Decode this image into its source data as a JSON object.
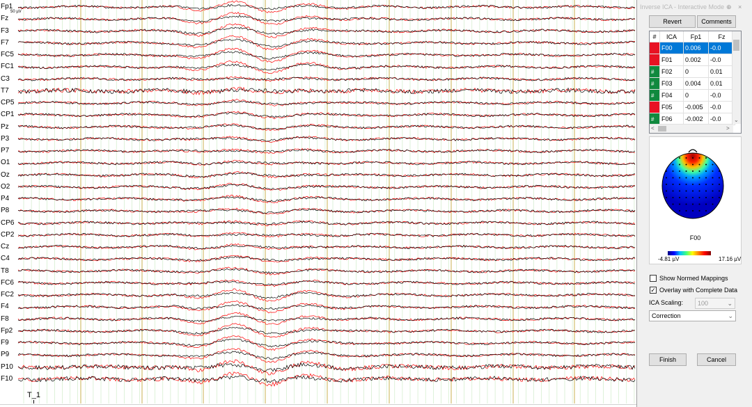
{
  "eeg": {
    "channels": [
      "Fp1",
      "Fz",
      "F3",
      "F7",
      "FC5",
      "FC1",
      "C3",
      "T7",
      "CP5",
      "CP1",
      "Pz",
      "P3",
      "P7",
      "O1",
      "Oz",
      "O2",
      "P4",
      "P8",
      "CP6",
      "CP2",
      "Cz",
      "C4",
      "T8",
      "FC6",
      "FC2",
      "F4",
      "F8",
      "Fp2",
      "F9",
      "P9",
      "P10",
      "F10"
    ],
    "scale_label": "50 µV",
    "marker_label": "T_1",
    "colors": {
      "raw": "#000000",
      "corrected": "#ff0000",
      "major_grid": "#c8b050",
      "minor_grid": "#c8e8c0"
    }
  },
  "panel": {
    "title": "Inverse ICA - Interactive Mode",
    "title_pin": "⊕",
    "title_close": "×",
    "revert_label": "Revert",
    "comments_label": "Comments",
    "table": {
      "headers": [
        "#",
        "ICA",
        "Fp1",
        "Fz"
      ],
      "rows": [
        {
          "flag": "",
          "flag_color": "#e81123",
          "ica": "F00",
          "fp1": "0.006",
          "fz": "-0.0",
          "selected": true
        },
        {
          "flag": "",
          "flag_color": "#e81123",
          "ica": "F01",
          "fp1": "0.002",
          "fz": "-0.0",
          "selected": false
        },
        {
          "flag": "#",
          "flag_color": "#10893e",
          "ica": "F02",
          "fp1": "0",
          "fz": "0.01",
          "selected": false
        },
        {
          "flag": "#",
          "flag_color": "#10893e",
          "ica": "F03",
          "fp1": "0.004",
          "fz": "0.01",
          "selected": false
        },
        {
          "flag": "#",
          "flag_color": "#10893e",
          "ica": "F04",
          "fp1": "0",
          "fz": "-0.0",
          "selected": false
        },
        {
          "flag": "",
          "flag_color": "#e81123",
          "ica": "F05",
          "fp1": "-0.005",
          "fz": "-0.0",
          "selected": false
        },
        {
          "flag": "#",
          "flag_color": "#10893e",
          "ica": "F06",
          "fp1": "-0.002",
          "fz": "-0.0",
          "selected": false
        }
      ]
    },
    "topo_label": "F00",
    "scale_min": "-4.81 µV",
    "scale_max": "17.16 µV",
    "show_normed_label": "Show Normed Mappings",
    "show_normed_checked": false,
    "overlay_label": "Overlay with Complete Data",
    "overlay_checked": true,
    "ica_scaling_label": "ICA Scaling:",
    "ica_scaling_value": "100",
    "mode_value": "Correction",
    "finish_label": "Finish",
    "cancel_label": "Cancel"
  }
}
